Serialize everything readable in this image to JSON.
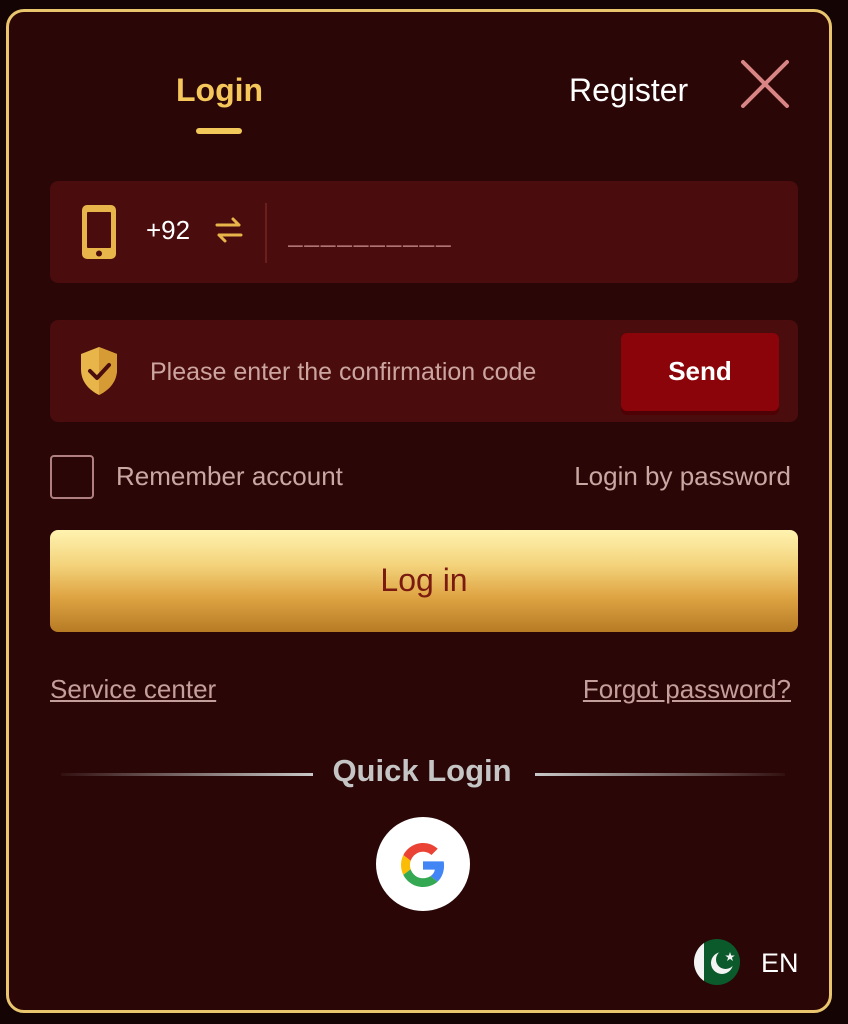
{
  "tabs": {
    "login": "Login",
    "register": "Register"
  },
  "phone": {
    "country_code": "+92",
    "placeholder": "__________"
  },
  "code": {
    "placeholder": "Please enter the confirmation code",
    "send_label": "Send"
  },
  "options": {
    "remember_label": "Remember account",
    "login_by_password": "Login by password"
  },
  "login_button": "Log in",
  "links": {
    "service_center": "Service center",
    "forgot_password": "Forgot password?"
  },
  "quick_login": {
    "title": "Quick Login",
    "provider_icon": "google-icon"
  },
  "language": {
    "code": "EN",
    "flag_icon": "pakistan-flag-icon"
  },
  "colors": {
    "accent": "#f5c75a",
    "background": "#2a0606",
    "field": "#4a0c0d",
    "send_button": "#8a0409",
    "border": "#e9c56e"
  }
}
